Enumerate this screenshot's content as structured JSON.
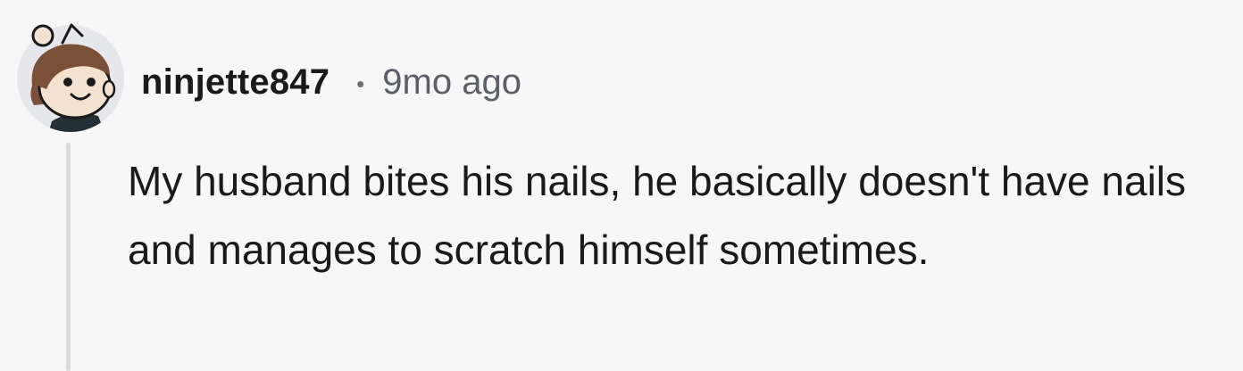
{
  "comment": {
    "username": "ninjette847",
    "separator": "•",
    "timestamp": "9mo ago",
    "body": "My husband bites his nails, he basically doesn't have nails and manages to scratch himself sometimes."
  },
  "avatar": {
    "icon": "snoo-avatar-icon"
  },
  "colors": {
    "background": "#f7f7f8",
    "text": "#1a1a1b",
    "meta_text": "#5c6066",
    "thread_line": "#dadcde",
    "avatar_bg": "#e6e7ea"
  }
}
